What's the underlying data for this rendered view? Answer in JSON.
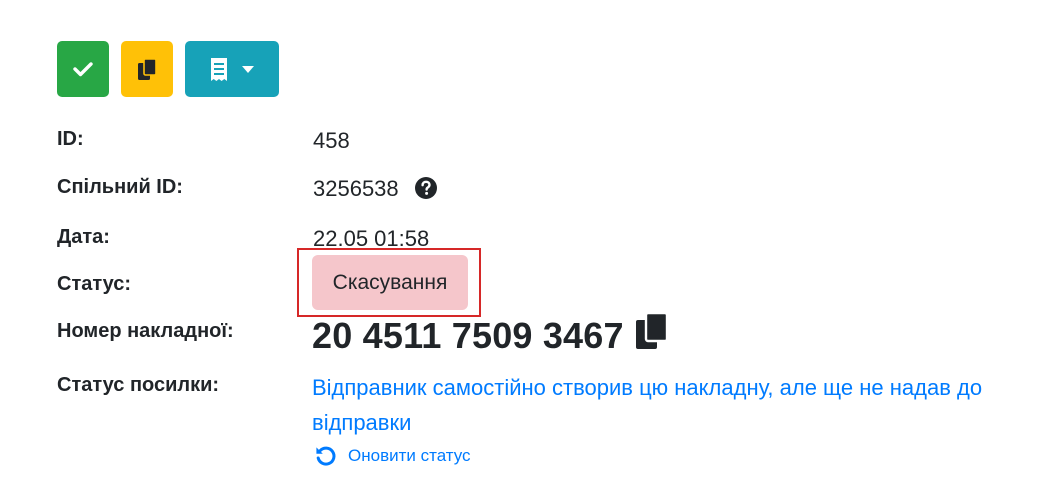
{
  "toolbar": {
    "buttons": [
      {
        "icon": "check-icon",
        "color": "#28a745"
      },
      {
        "icon": "copy-icon",
        "color": "#ffc107"
      },
      {
        "icon": "receipt-icon",
        "dropdown": true,
        "color": "#17a2b8"
      }
    ]
  },
  "details": {
    "id_label": "ID:",
    "id_value": "458",
    "shared_id_label": "Спільний ID:",
    "shared_id_value": "3256538",
    "date_label": "Дата:",
    "date_value": "22.05 01:58",
    "status_label": "Статус:",
    "status_value": "Скасування",
    "status_color": "#f5c6cb",
    "waybill_label": "Номер накладної:",
    "waybill_value": "20 4511 7509 3467",
    "parcel_status_label": "Статус посилки:",
    "parcel_status_value": "Відправник самостійно створив цю накладну, але ще не надав до відправки",
    "refresh_label": "Оновити статус"
  },
  "colors": {
    "link": "#007bff",
    "highlight_border": "#d62828"
  }
}
